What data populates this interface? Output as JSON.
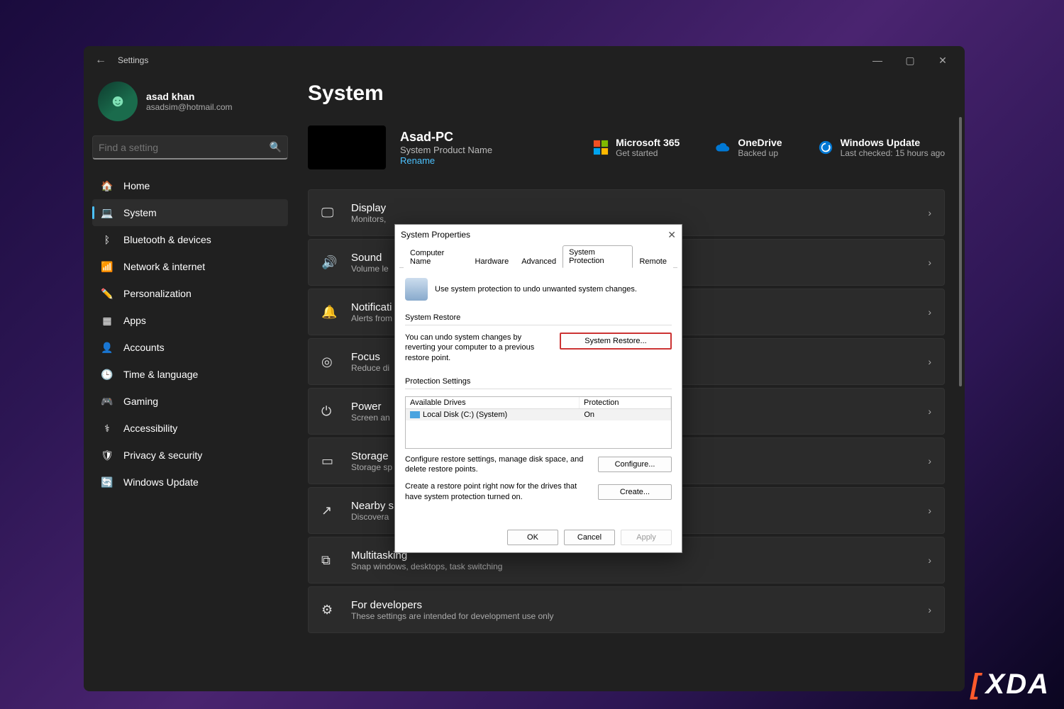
{
  "window": {
    "title": "Settings",
    "min": "—",
    "max": "▢",
    "close": "✕"
  },
  "user": {
    "name": "asad khan",
    "email": "asadsim@hotmail.com"
  },
  "search": {
    "placeholder": "Find a setting"
  },
  "nav": [
    {
      "label": "Home",
      "icon": "🏠"
    },
    {
      "label": "System",
      "icon": "💻",
      "active": true
    },
    {
      "label": "Bluetooth & devices",
      "icon": "ᛒ"
    },
    {
      "label": "Network & internet",
      "icon": "📶"
    },
    {
      "label": "Personalization",
      "icon": "✏️"
    },
    {
      "label": "Apps",
      "icon": "▦"
    },
    {
      "label": "Accounts",
      "icon": "👤"
    },
    {
      "label": "Time & language",
      "icon": "🕒"
    },
    {
      "label": "Gaming",
      "icon": "🎮"
    },
    {
      "label": "Accessibility",
      "icon": "⚕"
    },
    {
      "label": "Privacy & security",
      "icon": "🛡"
    },
    {
      "label": "Windows Update",
      "icon": "🔄"
    }
  ],
  "page": {
    "heading": "System"
  },
  "pc": {
    "name": "Asad-PC",
    "product": "System Product Name",
    "rename": "Rename"
  },
  "status": [
    {
      "title": "Microsoft 365",
      "sub": "Get started"
    },
    {
      "title": "OneDrive",
      "sub": "Backed up"
    },
    {
      "title": "Windows Update",
      "sub": "Last checked: 15 hours ago"
    }
  ],
  "cards": [
    {
      "icon": "🖵",
      "title": "Display",
      "sub": "Monitors,"
    },
    {
      "icon": "🔊",
      "title": "Sound",
      "sub": "Volume le"
    },
    {
      "icon": "🔔",
      "title": "Notificati",
      "sub": "Alerts from"
    },
    {
      "icon": "◎",
      "title": "Focus",
      "sub": "Reduce di"
    },
    {
      "icon": "⏻",
      "title": "Power",
      "sub": "Screen an"
    },
    {
      "icon": "▭",
      "title": "Storage",
      "sub": "Storage sp"
    },
    {
      "icon": "↗",
      "title": "Nearby s",
      "sub": "Discovera"
    },
    {
      "icon": "⧉",
      "title": "Multitasking",
      "sub": "Snap windows, desktops, task switching"
    },
    {
      "icon": "⚙",
      "title": "For developers",
      "sub": "These settings are intended for development use only"
    }
  ],
  "dialog": {
    "title": "System Properties",
    "tabs": [
      "Computer Name",
      "Hardware",
      "Advanced",
      "System Protection",
      "Remote"
    ],
    "active_tab": 3,
    "intro": "Use system protection to undo unwanted system changes.",
    "section1_label": "System Restore",
    "sr_text": "You can undo system changes by reverting your computer to a previous restore point.",
    "sr_btn": "System Restore...",
    "section2_label": "Protection Settings",
    "table_head1": "Available Drives",
    "table_head2": "Protection",
    "drive_name": "Local Disk (C:) (System)",
    "drive_status": "On",
    "cfg_text": "Configure restore settings, manage disk space, and delete restore points.",
    "cfg_btn": "Configure...",
    "create_text": "Create a restore point right now for the drives that have system protection turned on.",
    "create_btn": "Create...",
    "ok": "OK",
    "cancel": "Cancel",
    "apply": "Apply",
    "close": "✕"
  },
  "watermark": "XDA"
}
